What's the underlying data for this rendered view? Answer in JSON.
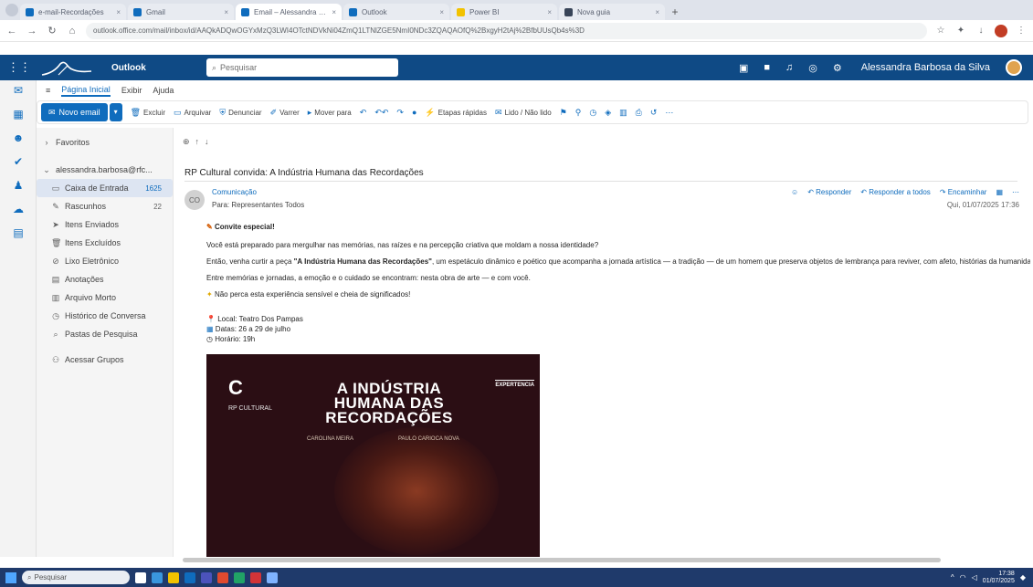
{
  "browser": {
    "tabs": [
      {
        "label": "e-mail-Recordações",
        "active": false,
        "favicon": "blue"
      },
      {
        "label": "Gmail",
        "active": false,
        "favicon": "blue"
      },
      {
        "label": "Email – Alessandra Barbosa Da Silva – Outlook",
        "active": true,
        "favicon": "blue"
      },
      {
        "label": "Outlook",
        "active": false,
        "favicon": "blue"
      },
      {
        "label": "Power BI",
        "active": false,
        "favicon": "yellow"
      },
      {
        "label": "Nova guia",
        "active": false,
        "favicon": "dark"
      }
    ],
    "url": "outlook.office.com/mail/inbox/id/AAQkADQwOGYxMzQ3LWI4OTctNDVkNi04ZmQ1LTNlZGE5NmI0NDc3ZQAQAOfQ%2BxgyH2tAj%2BfbUUsQb4s%3D"
  },
  "outlook": {
    "app_name": "Outlook",
    "search_placeholder": "Pesquisar",
    "user_name": "Alessandra Barbosa da Silva",
    "ribbon_tabs": [
      "Página Inicial",
      "Exibir",
      "Ajuda"
    ],
    "ribbon": {
      "new_mail": "Novo email",
      "excluir": "Excluir",
      "arquivar": "Arquivar",
      "denunciar": "Denunciar",
      "varrer": "Varrer",
      "mover_para": "Mover para",
      "etapas_rapidas": "Etapas rápidas",
      "marcar": "Lido / Não lido"
    },
    "folders": {
      "favorites": "Favoritos",
      "account": "alessandra.barbosa@rfc...",
      "items": [
        {
          "name": "Caixa de Entrada",
          "count": "1625",
          "icon": "inbox-icon"
        },
        {
          "name": "Rascunhos",
          "count": "22",
          "icon": "draft-icon"
        },
        {
          "name": "Itens Enviados",
          "count": "",
          "icon": "sent-icon"
        },
        {
          "name": "Itens Excluídos",
          "count": "",
          "icon": "trash-icon"
        },
        {
          "name": "Lixo Eletrônico",
          "count": "",
          "icon": "junk-icon"
        },
        {
          "name": "Anotações",
          "count": "",
          "icon": "note-icon"
        },
        {
          "name": "Arquivo Morto",
          "count": "",
          "icon": "archive-icon"
        },
        {
          "name": "Histórico de Conversa",
          "count": "",
          "icon": "history-icon"
        },
        {
          "name": "Pastas de Pesquisa",
          "count": "",
          "icon": "search-folder-icon"
        }
      ],
      "manage_groups": "Acessar Grupos"
    }
  },
  "message": {
    "subject": "RP Cultural convida: A Indústria Humana das Recordações",
    "sender_initials": "CO",
    "sender": "Comunicação",
    "to": "Para: Representantes Todos",
    "actions": [
      "Responder",
      "Responder a todos",
      "Encaminhar"
    ],
    "date": "Qui, 01/07/2025 17:36",
    "greeting": "Convite especial!",
    "p1": "Você está preparado para mergulhar nas memórias, nas raízes e na percepção criativa que moldam a nossa identidade?",
    "p2_start": "Então, venha curtir a peça ",
    "p2_bold": "\"A Indústria Humana das Recordações\"",
    "p2_end": ", um espetáculo dinâmico e poético que acompanha a jornada artística — a tradição — de um homem que preserva objetos de lembrança para reviver, com afeto, histórias da humanidade.",
    "p3": "Entre memórias e jornadas, a emoção e o cuidado se encontram: nesta obra de arte — e com você.",
    "p4": "Não perca esta experiência sensível e cheia de significados!",
    "local": "Local: Teatro Dos Pampas",
    "datas": "Datas: 26 a 29 de julho",
    "horario": "Horário: 19h"
  },
  "poster": {
    "title_lines": [
      "A INDÚSTRIA",
      "HUMANA DAS",
      "RECORDAÇÕES"
    ],
    "brand": "RP CULTURAL",
    "partner": "EXPERTENCIA",
    "artist_left": "CAROLINA MEIRA",
    "artist_right": "PAULO CARIOCA NOVA"
  },
  "taskbar": {
    "search": "Pesquisar",
    "time": "17:38",
    "date": "01/07/2025"
  }
}
